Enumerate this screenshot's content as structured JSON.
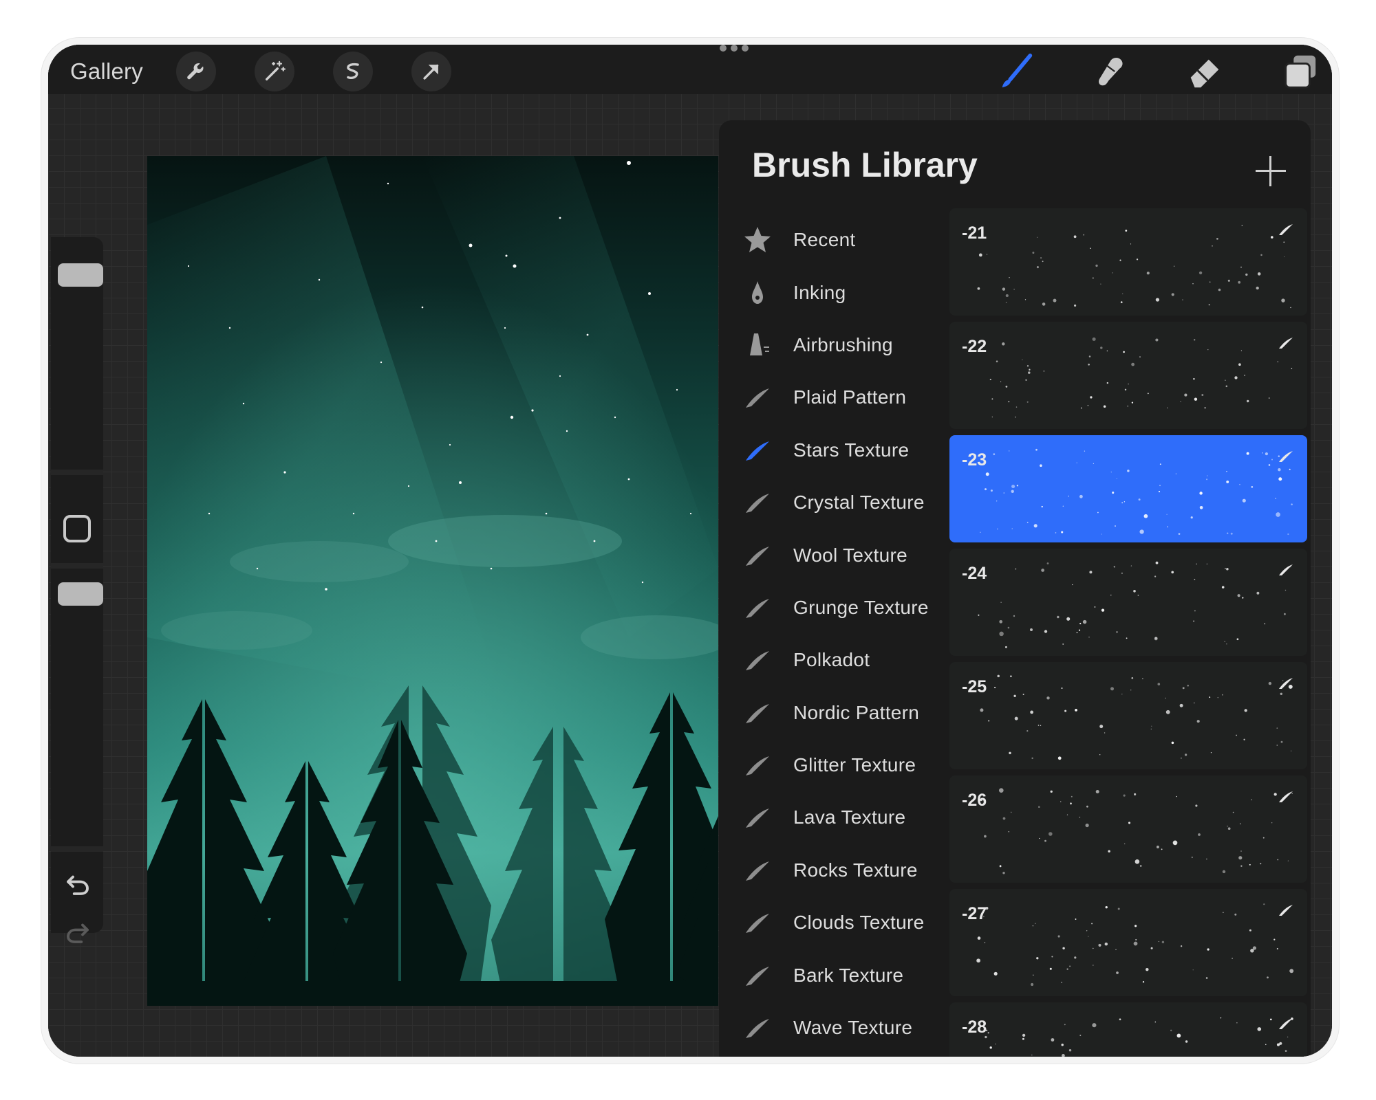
{
  "toolbar": {
    "gallery_label": "Gallery",
    "left_tools": [
      "wrench-icon",
      "magic-wand-icon",
      "selection-icon",
      "transform-arrow-icon"
    ],
    "right_tools": [
      "brush-icon",
      "smudge-icon",
      "eraser-icon",
      "layers-icon"
    ],
    "active_color": "#2f6dfa"
  },
  "panel": {
    "title": "Brush Library",
    "categories": [
      {
        "label": "Recent",
        "icon": "star-icon"
      },
      {
        "label": "Inking",
        "icon": "ink-drop-icon"
      },
      {
        "label": "Airbrushing",
        "icon": "airbrush-icon"
      },
      {
        "label": "Plaid Pattern",
        "icon": "brush-stroke-icon"
      },
      {
        "label": "Stars Texture",
        "icon": "brush-stroke-icon",
        "active": true
      },
      {
        "label": "Crystal Texture",
        "icon": "brush-stroke-icon"
      },
      {
        "label": "Wool Texture",
        "icon": "brush-stroke-icon"
      },
      {
        "label": "Grunge Texture",
        "icon": "brush-stroke-icon"
      },
      {
        "label": "Polkadot",
        "icon": "brush-stroke-icon"
      },
      {
        "label": "Nordic Pattern",
        "icon": "brush-stroke-icon"
      },
      {
        "label": "Glitter Texture",
        "icon": "brush-stroke-icon"
      },
      {
        "label": "Lava Texture",
        "icon": "brush-stroke-icon"
      },
      {
        "label": "Rocks Texture",
        "icon": "brush-stroke-icon"
      },
      {
        "label": "Clouds Texture",
        "icon": "brush-stroke-icon"
      },
      {
        "label": "Bark Texture",
        "icon": "brush-stroke-icon"
      },
      {
        "label": "Wave Texture",
        "icon": "brush-stroke-icon"
      }
    ],
    "brushes": [
      {
        "name": "-21"
      },
      {
        "name": "-22"
      },
      {
        "name": "-23",
        "selected": true
      },
      {
        "name": "-24"
      },
      {
        "name": "-25"
      },
      {
        "name": "-26"
      },
      {
        "name": "-27"
      },
      {
        "name": "-28"
      }
    ]
  }
}
